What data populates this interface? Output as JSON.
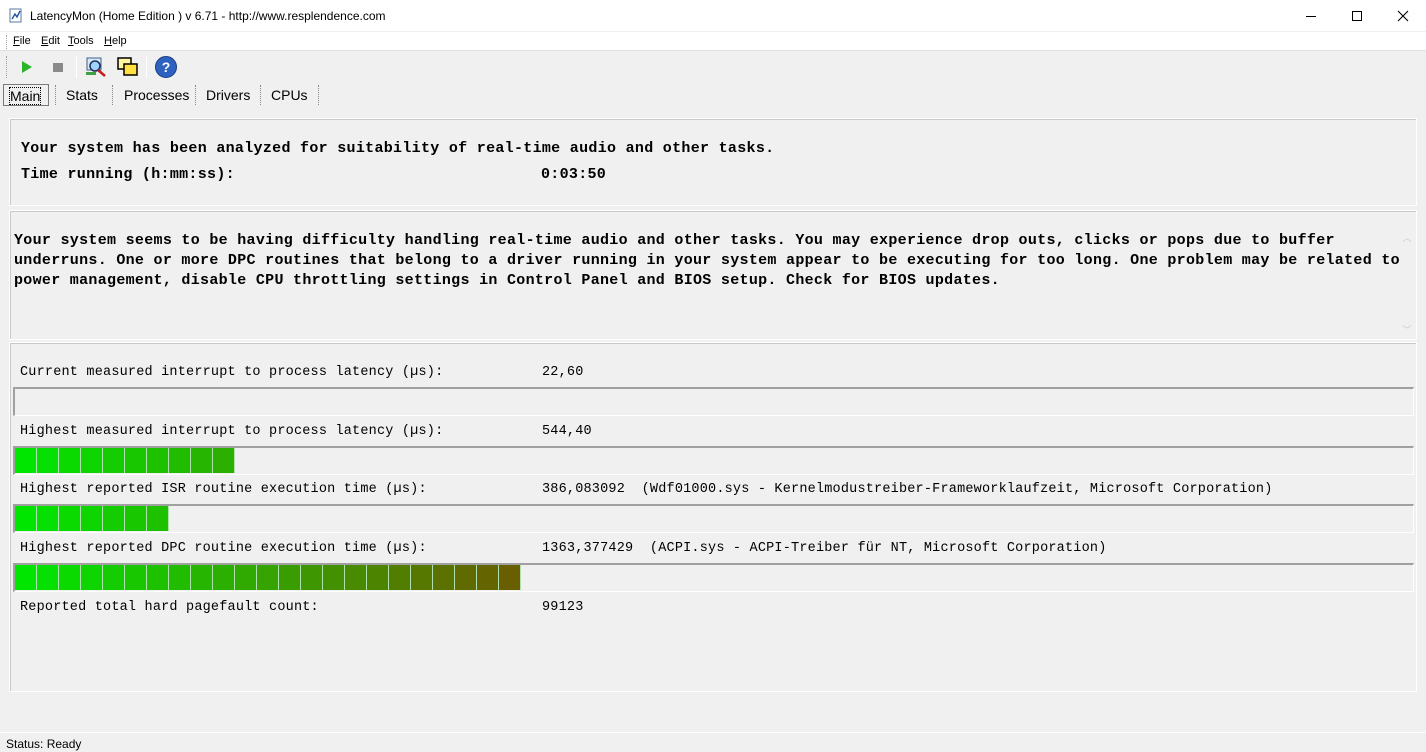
{
  "window": {
    "title": "LatencyMon  (Home Edition )  v 6.71 - http://www.resplendence.com"
  },
  "menu": {
    "items": [
      "File",
      "Edit",
      "Tools",
      "Help"
    ]
  },
  "toolbar": {
    "buttons": [
      {
        "name": "start",
        "icon": "play-icon",
        "color": "#22aa22"
      },
      {
        "name": "stop",
        "icon": "stop-icon",
        "color": "#808080"
      },
      {
        "name": "search",
        "icon": "magnify-icon"
      },
      {
        "name": "windows",
        "icon": "windows-icon"
      },
      {
        "name": "help",
        "icon": "help-icon",
        "color": "#2e62c0"
      }
    ]
  },
  "tabs": [
    "Main",
    "Stats",
    "Processes",
    "Drivers",
    "CPUs"
  ],
  "summary": {
    "line1": "Your system has been analyzed for suitability of real-time audio and other tasks.",
    "time_label": "Time running (h:mm:ss):",
    "time_value": "0:03:50"
  },
  "verdict": {
    "text": "Your system seems to be having difficulty handling real-time audio and other tasks. You may experience drop outs, clicks or pops due to buffer underruns. One or more DPC routines that belong to a driver running in your system appear to be executing for too long. One problem may be related to power management, disable CPU throttling settings in Control Panel and BIOS setup. Check for BIOS updates."
  },
  "metrics": [
    {
      "label": "Current measured interrupt to process latency (µs):",
      "value": "22,60",
      "segments": 0
    },
    {
      "label": "Highest measured interrupt to process latency (µs):",
      "value": "544,40",
      "segments": 10
    },
    {
      "label": "Highest reported ISR routine execution time (µs):",
      "value": "386,083092  (Wdf01000.sys - Kernelmodustreiber-Frameworklaufzeit, Microsoft Corporation)",
      "segments": 7
    },
    {
      "label": "Highest reported DPC routine execution time (µs):",
      "value": "1363,377429  (ACPI.sys - ACPI-Treiber für NT, Microsoft Corporation)",
      "segments": 23
    },
    {
      "label": "Reported total hard pagefault count:",
      "value": "99123"
    }
  ],
  "status": {
    "text": "Status: Ready"
  }
}
